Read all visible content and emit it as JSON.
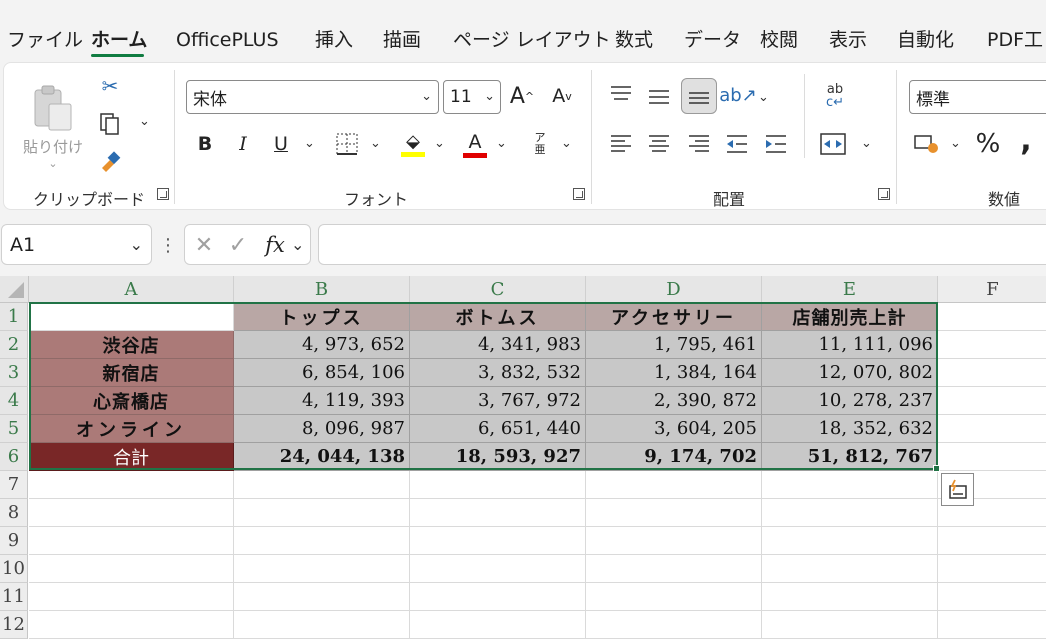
{
  "menu": [
    "ファイル",
    "ホーム",
    "OfficePLUS",
    "挿入",
    "描画",
    "ページ レイアウト",
    "数式",
    "データ",
    "校閲",
    "表示",
    "自動化",
    "PDF工"
  ],
  "ribbon": {
    "paste_label": "貼り付け",
    "clipboard_group": "クリップボード",
    "font_name": "宋体",
    "font_size": "11",
    "font_group": "フォント",
    "bold": "B",
    "italic": "I",
    "underline": "U",
    "align_group": "配置",
    "number_format": "標準",
    "number_group": "数値",
    "percent": "%",
    "comma": ","
  },
  "formula_bar": {
    "name_box": "A1",
    "formula": ""
  },
  "columns": [
    "A",
    "B",
    "C",
    "D",
    "E",
    "F"
  ],
  "rows": [
    "1",
    "2",
    "3",
    "4",
    "5",
    "6",
    "7",
    "8",
    "9",
    "10",
    "11",
    "12"
  ],
  "table": {
    "headers": [
      "トップス",
      "ボトムス",
      "アクセサリー",
      "店舗別売上計"
    ],
    "stores": [
      "渋谷店",
      "新宿店",
      "心斎橋店",
      "オンライン"
    ],
    "values": [
      [
        "4, 973, 652",
        "4, 341, 983",
        "1, 795, 461",
        "11, 111, 096"
      ],
      [
        "6, 854, 106",
        "3, 832, 532",
        "1, 384, 164",
        "12, 070, 802"
      ],
      [
        "4, 119, 393",
        "3, 767, 972",
        "2, 390, 872",
        "10, 278, 237"
      ],
      [
        "8, 096, 987",
        "6, 651, 440",
        "3, 604, 205",
        "18, 352, 632"
      ]
    ],
    "total_label": "合計",
    "totals": [
      "24, 044, 138",
      "18, 593, 927",
      "9, 174, 702",
      "51, 812, 767"
    ]
  }
}
